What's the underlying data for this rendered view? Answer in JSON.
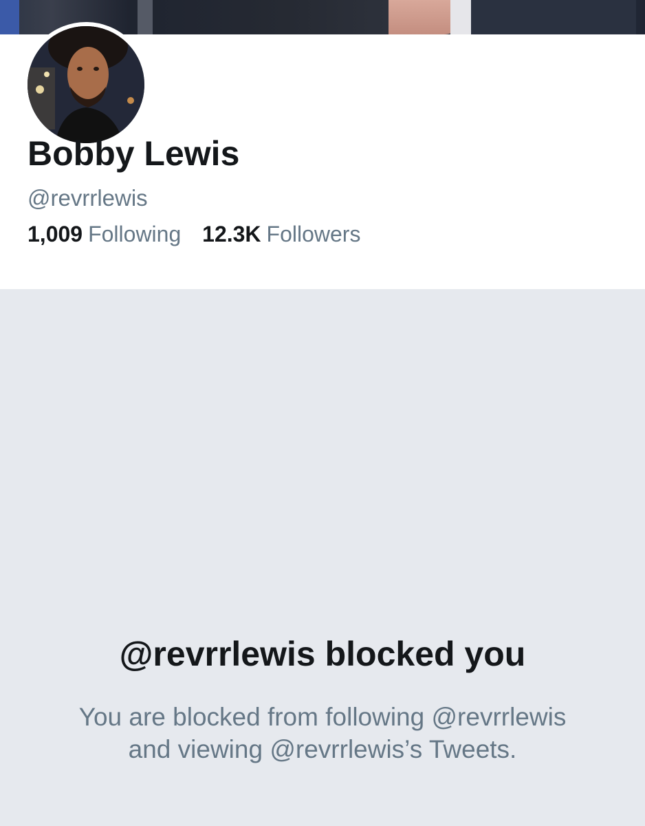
{
  "profile": {
    "name": "Bobby Lewis",
    "handle": "@revrrlewis",
    "following_count": "1,009",
    "following_label": "Following",
    "followers_count": "12.3K",
    "followers_label": "Followers"
  },
  "blocked": {
    "title": "@revrrlewis blocked you",
    "message": "You are blocked from following @revrrlewis and viewing @revrrlewis’s Tweets."
  },
  "colors": {
    "text_primary": "#14171a",
    "text_secondary": "#657786",
    "blocked_background": "#e6e9ee"
  }
}
